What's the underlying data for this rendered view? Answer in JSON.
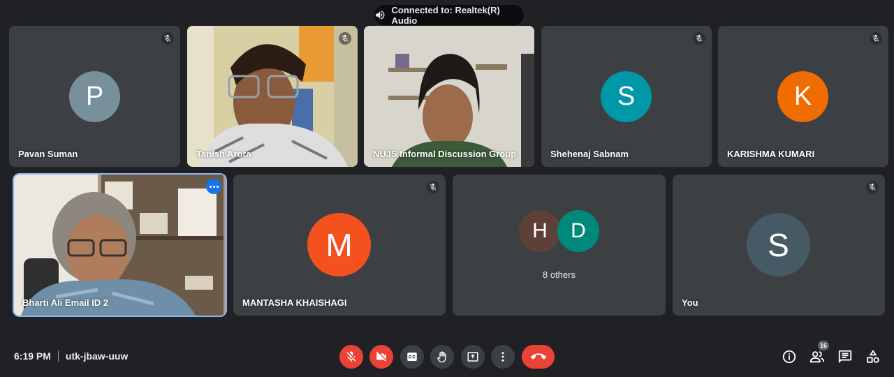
{
  "toast": {
    "text": "Connected to: Realtek(R) Audio",
    "icon": "speaker-icon"
  },
  "participants": [
    {
      "name": "Pavan Suman",
      "initial": "P",
      "color": "#78909c",
      "muted": true
    },
    {
      "name": "Tanish Arora",
      "video": true,
      "muted": true
    },
    {
      "name": "NUJS Informal Discussion Group",
      "video": true,
      "muted": false
    },
    {
      "name": "Shehenaj Sabnam",
      "initial": "S",
      "color": "#0097a7",
      "muted": true
    },
    {
      "name": "KARISHMA KUMARI",
      "initial": "K",
      "color": "#ef6c00",
      "muted": true
    },
    {
      "name": "Bharti Ali Email ID 2",
      "video": true,
      "speaking": true
    },
    {
      "name": "MANTASHA KHAISHAGI",
      "initial": "M",
      "color": "#f4511e",
      "muted": true
    },
    {
      "others_label": "8 others",
      "avatars": [
        {
          "initial": "H",
          "color": "#5d4037"
        },
        {
          "initial": "D",
          "color": "#00897b"
        }
      ]
    },
    {
      "name": "You",
      "initial": "S",
      "color": "#455a64",
      "muted": true
    }
  ],
  "footer": {
    "time": "6:19 PM",
    "meeting_code": "utk-jbaw-uuw",
    "people_count": "16"
  },
  "colors": {
    "accent": "#1a73e8",
    "danger": "#ea4335",
    "tile": "#3c4043",
    "background": "#202124"
  }
}
